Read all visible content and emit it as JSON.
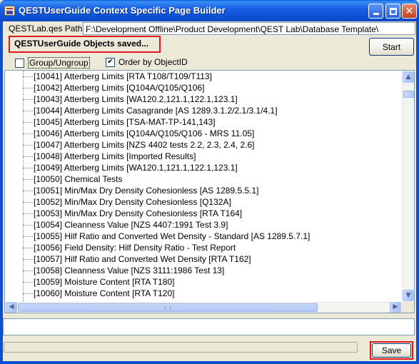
{
  "window": {
    "title": "QESTUserGuide Context Specific Page Builder",
    "controls": {
      "minimize": "_",
      "maximize": "□",
      "close": "✕"
    }
  },
  "path": {
    "label": "QESTLab.qes Path:",
    "value": "F:\\Development Offline\\Product Development\\QEST Lab\\Database Template\\"
  },
  "status": {
    "text": "QESTUserGuide Objects saved..."
  },
  "buttons": {
    "start": "Start",
    "save": "Save"
  },
  "options": {
    "group_label": "Group/Ungroup",
    "group_checked": false,
    "order_label": "Order by ObjectID",
    "order_checked": true,
    "check_glyph": "✔"
  },
  "tree": {
    "items": [
      "[10041] Atterberg Limits [RTA T108/T109/T113]",
      "[10042] Atterberg Limits [Q104A/Q105/Q106]",
      "[10043] Atterberg Limits [WA120.2,121.1,122.1,123.1]",
      "[10044] Atterberg Limits Casagrande [AS 1289.3.1.2/2.1/3.1/4.1]",
      "[10045] Atterberg Limits [TSA-MAT-TP-141,143]",
      "[10046] Atterberg Limits [Q104A/Q105/Q106 - MRS 11.05]",
      "[10047] Atterberg Limits [NZS 4402 tests 2.2, 2.3, 2.4, 2.6]",
      "[10048] Atterberg Limits [Imported Results]",
      "[10049] Atterberg Limits [WA120.1,121.1,122.1,123.1]",
      "[10050] Chemical Tests",
      "[10051] Min/Max Dry Density Cohesionless [AS 1289.5.5.1]",
      "[10052] Min/Max Dry Density Cohesionless [Q132A]",
      "[10053] Min/Max Dry Density Cohesionless [RTA T164]",
      "[10054] Cleanness Value [NZS 4407:1991 Test 3.9]",
      "[10055] Hilf Ratio and Converted Wet Density - Standard [AS 1289.5.7.1]",
      "[10056] Field Density: Hilf Density Ratio - Test Report",
      "[10057] Hilf Ratio and Converted Wet Density [RTA T162]",
      "[10058] Cleanness Value [NZS 3111:1986 Test 13]",
      "[10059] Moisture Content [RTA T180]",
      "[10060] Moisture Content [RTA T120]"
    ],
    "scroll": {
      "up": "▲",
      "down": "▼",
      "left": "◀",
      "right": "▶"
    }
  }
}
